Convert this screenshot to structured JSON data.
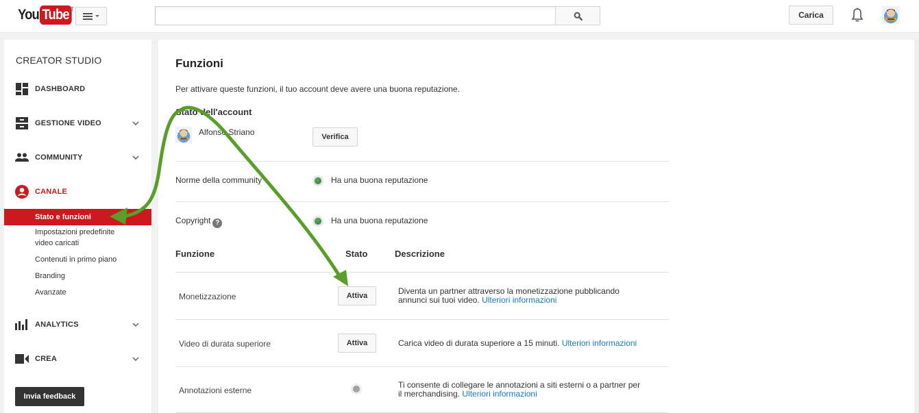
{
  "masthead": {
    "logo_you": "You",
    "logo_tube": "Tube",
    "locale": "IT",
    "search_placeholder": "",
    "search_value": "",
    "upload_label": "Carica"
  },
  "sidebar": {
    "title": "CREATOR STUDIO",
    "items": [
      {
        "label": "DASHBOARD",
        "icon": "dashboard-icon",
        "expandable": false
      },
      {
        "label": "GESTIONE VIDEO",
        "icon": "video-manager-icon",
        "expandable": true
      },
      {
        "label": "COMMUNITY",
        "icon": "community-icon",
        "expandable": true
      },
      {
        "label": "CANALE",
        "icon": "channel-icon",
        "expandable": false,
        "active": true
      },
      {
        "label": "ANALYTICS",
        "icon": "analytics-icon",
        "expandable": true
      },
      {
        "label": "CREA",
        "icon": "create-icon",
        "expandable": true
      }
    ],
    "channel_subitems": [
      {
        "label": "Stato e funzioni",
        "active": true
      },
      {
        "label_line1": "Impostazioni predefinite",
        "label_line2": "video caricati"
      },
      {
        "label": "Contenuti in primo piano"
      },
      {
        "label": "Branding"
      },
      {
        "label": "Avanzate"
      }
    ],
    "feedback_label": "Invia feedback"
  },
  "main": {
    "title": "Funzioni",
    "intro": "Per attivare queste funzioni, il tuo account deve avere una buona reputazione.",
    "account_status_title": "Stato dell'account",
    "account_name": "Alfonso Striano",
    "verify_label": "Verifica",
    "standing": [
      {
        "label": "Norme della community",
        "status": "Ha una buona reputazione",
        "status_color": "#2e7d32",
        "help": false
      },
      {
        "label": "Copyright",
        "status": "Ha una buona reputazione",
        "status_color": "#2e7d32",
        "help": true
      }
    ],
    "table_headers": {
      "feature": "Funzione",
      "status": "Stato",
      "description": "Descrizione"
    },
    "features": [
      {
        "name": "Monetizzazione",
        "status": "button",
        "button_label": "Attiva",
        "desc_line1": "Diventa un partner attraverso la monetizzazione pubblicando",
        "desc_line2": "annunci sui tuoi video.",
        "link": "Ulteriori informazioni"
      },
      {
        "name": "Video di durata superiore",
        "status": "button",
        "button_label": "Attiva",
        "desc_line1": "Carica video di durata superiore a 15 minuti.",
        "link": "Ulteriori informazioni"
      },
      {
        "name": "Annotazioni esterne",
        "status": "disabled",
        "status_color": "#a4a4a4",
        "desc_line1": "Ti consente di collegare le annotazioni a siti esterni o a partner per",
        "desc_line2": "il merchandising.",
        "link": "Ulteriori informazioni"
      }
    ]
  },
  "colors": {
    "brand_red": "#cc181e",
    "link_blue": "#167ac6",
    "annotation_green": "#5a9e2a",
    "good_standing": "#2e7d32"
  }
}
